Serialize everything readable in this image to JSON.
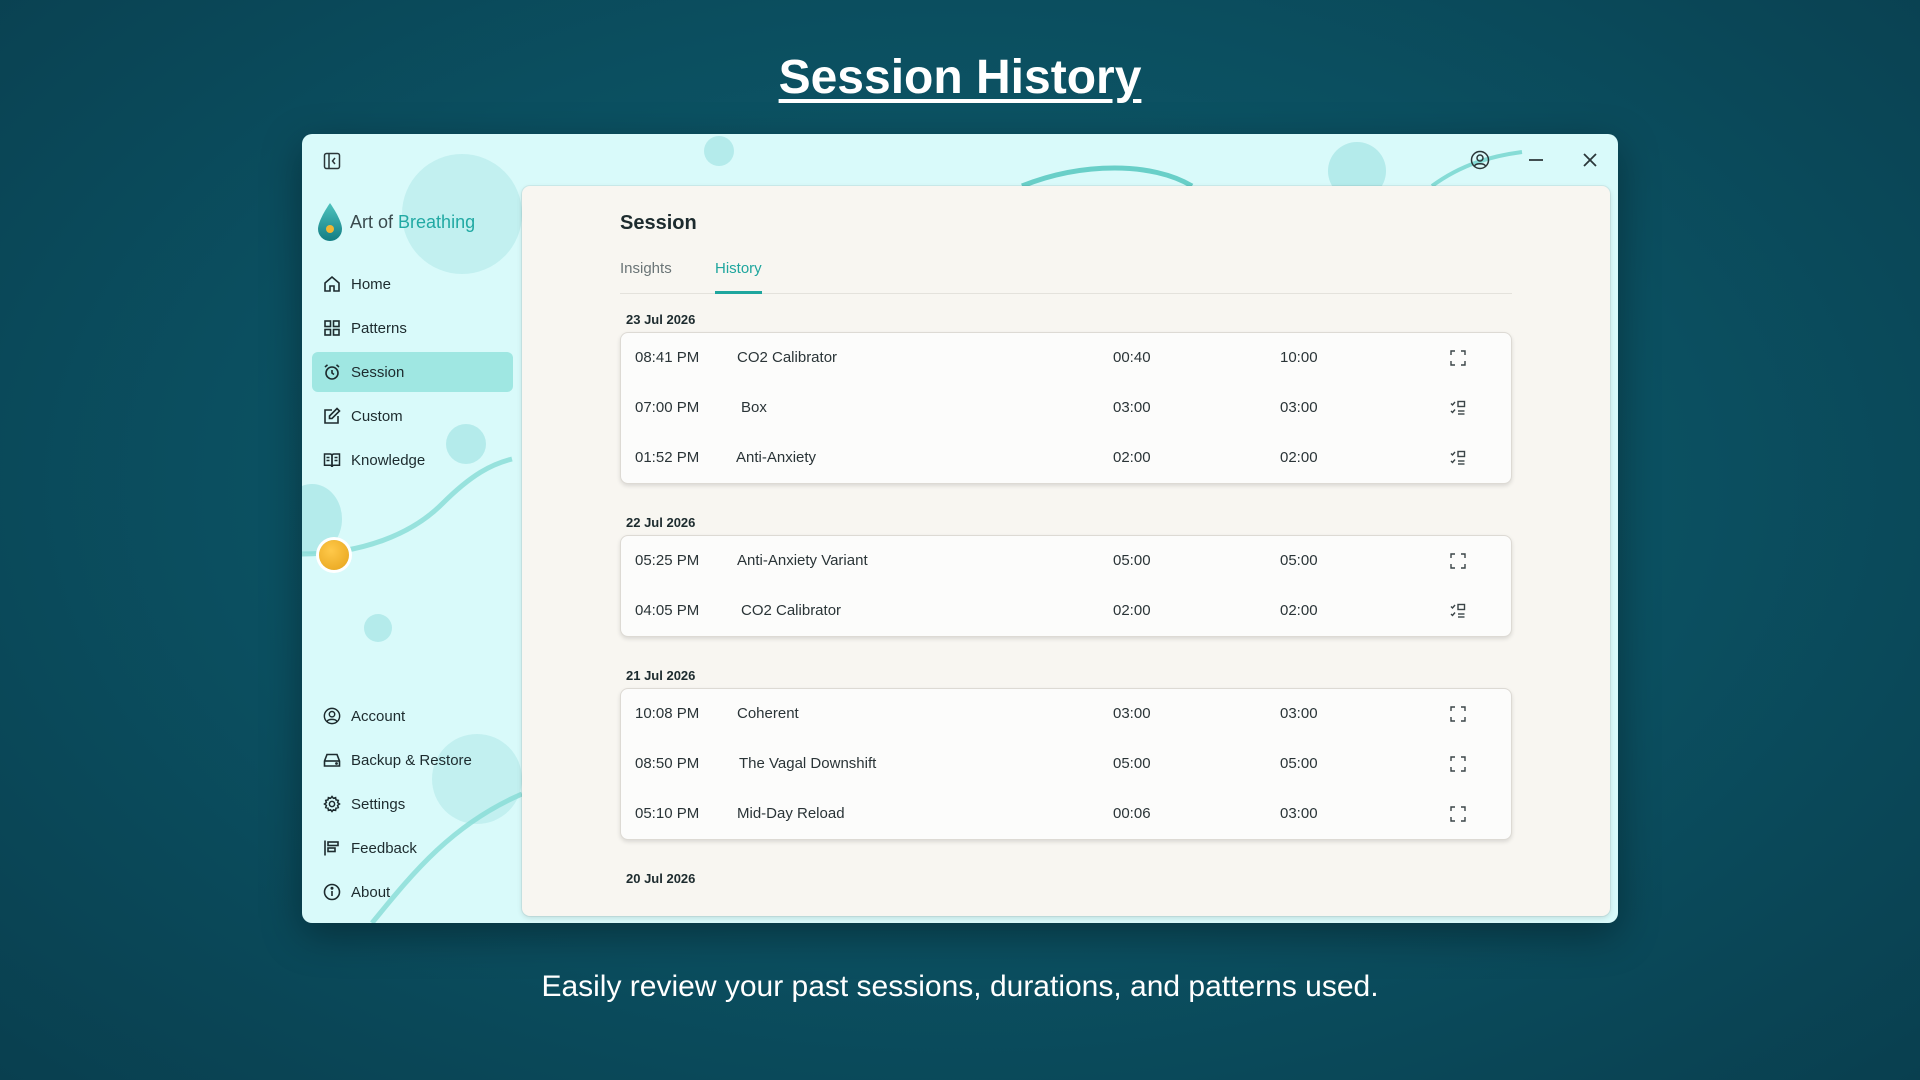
{
  "promo": {
    "title": "Session History",
    "caption": "Easily review your past sessions, durations, and patterns used."
  },
  "app": {
    "logo_prefix": "Art of",
    "logo_accent": "Breathing",
    "accent_color": "#1fa69e"
  },
  "sidebar": {
    "nav": [
      {
        "label": "Home",
        "icon": "home-icon"
      },
      {
        "label": "Patterns",
        "icon": "grid-icon"
      },
      {
        "label": "Session",
        "icon": "alarm-clock-icon",
        "active": true
      },
      {
        "label": "Custom",
        "icon": "edit-icon"
      },
      {
        "label": "Knowledge",
        "icon": "book-icon"
      }
    ],
    "bottom": [
      {
        "label": "Account",
        "icon": "user-circle-icon"
      },
      {
        "label": "Backup & Restore",
        "icon": "drive-icon"
      },
      {
        "label": "Settings",
        "icon": "gear-icon"
      },
      {
        "label": "Feedback",
        "icon": "feedback-icon"
      },
      {
        "label": "About",
        "icon": "info-icon"
      }
    ]
  },
  "main": {
    "title": "Session",
    "tabs": [
      {
        "label": "Insights",
        "active": false
      },
      {
        "label": "History",
        "active": true
      }
    ],
    "groups": [
      {
        "date": "23 Jul 2026",
        "sessions": [
          {
            "time": "08:41 PM",
            "pattern": "CO2 Calibrator",
            "duration": "00:40",
            "target": "10:00",
            "icon": "expand-icon"
          },
          {
            "time": "07:00 PM",
            "pattern": "Box",
            "duration": "03:00",
            "target": "03:00",
            "icon": "checklist-icon"
          },
          {
            "time": "01:52 PM",
            "pattern": "Anti-Anxiety",
            "duration": "02:00",
            "target": "02:00",
            "icon": "checklist-icon"
          }
        ]
      },
      {
        "date": "22 Jul 2026",
        "sessions": [
          {
            "time": "05:25 PM",
            "pattern": "Anti-Anxiety Variant",
            "duration": "05:00",
            "target": "05:00",
            "icon": "expand-icon"
          },
          {
            "time": "04:05 PM",
            "pattern": "CO2 Calibrator",
            "duration": "02:00",
            "target": "02:00",
            "icon": "checklist-icon"
          }
        ]
      },
      {
        "date": "21 Jul 2026",
        "sessions": [
          {
            "time": "10:08 PM",
            "pattern": "Coherent",
            "duration": "03:00",
            "target": "03:00",
            "icon": "expand-icon"
          },
          {
            "time": "08:50 PM",
            "pattern": "The Vagal Downshift",
            "duration": "05:00",
            "target": "05:00",
            "icon": "expand-icon"
          },
          {
            "time": "05:10 PM",
            "pattern": "Mid-Day Reload",
            "duration": "00:06",
            "target": "03:00",
            "icon": "expand-icon"
          }
        ]
      },
      {
        "date": "20 Jul 2026",
        "sessions": []
      }
    ]
  }
}
